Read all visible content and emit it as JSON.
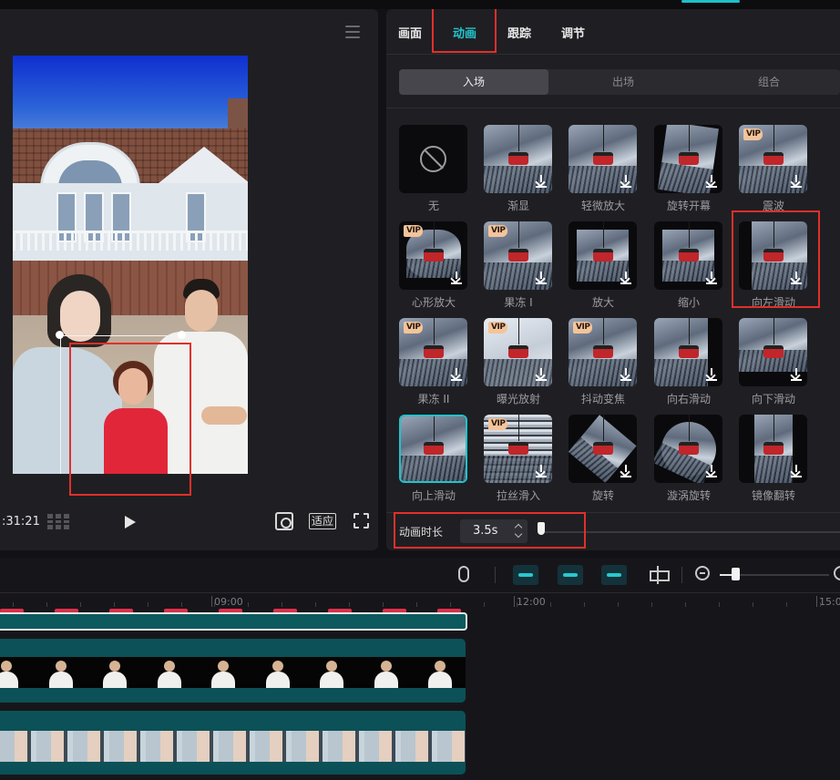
{
  "preview": {
    "timecode": ":31:21",
    "fit_label": "适应"
  },
  "panel": {
    "tabs": [
      {
        "label": "画面"
      },
      {
        "label": "动画"
      },
      {
        "label": "跟踪"
      },
      {
        "label": "调节"
      }
    ],
    "active_tab": "动画",
    "subtabs": [
      {
        "label": "入场"
      },
      {
        "label": "出场"
      },
      {
        "label": "组合"
      }
    ],
    "active_subtab": "入场",
    "animations": [
      {
        "label": "无",
        "vip": false,
        "download": false
      },
      {
        "label": "渐显",
        "vip": false,
        "download": true
      },
      {
        "label": "轻微放大",
        "vip": false,
        "download": true
      },
      {
        "label": "旋转开幕",
        "vip": false,
        "download": true
      },
      {
        "label": "震波",
        "vip": true,
        "download": true
      },
      {
        "label": "心形放大",
        "vip": true,
        "download": true
      },
      {
        "label": "果冻 I",
        "vip": true,
        "download": true
      },
      {
        "label": "放大",
        "vip": false,
        "download": true
      },
      {
        "label": "缩小",
        "vip": false,
        "download": true
      },
      {
        "label": "向左滑动",
        "vip": false,
        "download": true
      },
      {
        "label": "果冻 II",
        "vip": true,
        "download": true
      },
      {
        "label": "曝光放射",
        "vip": true,
        "download": true
      },
      {
        "label": "抖动变焦",
        "vip": true,
        "download": true
      },
      {
        "label": "向右滑动",
        "vip": false,
        "download": true
      },
      {
        "label": "向下滑动",
        "vip": false,
        "download": true
      },
      {
        "label": "向上滑动",
        "vip": false,
        "download": false,
        "selected": true
      },
      {
        "label": "拉丝滑入",
        "vip": true,
        "download": true
      },
      {
        "label": "旋转",
        "vip": false,
        "download": true
      },
      {
        "label": "漩涡旋转",
        "vip": false,
        "download": true
      },
      {
        "label": "镜像翻转",
        "vip": false,
        "download": true
      }
    ],
    "vip_badge": "VIP",
    "duration": {
      "label": "动画时长",
      "value": "3.5s"
    }
  },
  "timeline": {
    "ruler": [
      {
        "label": "09:00"
      },
      {
        "label": "12:00"
      },
      {
        "label": "15:0"
      }
    ]
  },
  "colors": {
    "accent": "#24c4cc",
    "highlight_box": "#e0302a",
    "panel_bg": "#1f1f23",
    "track_teal": "#0b5157"
  }
}
